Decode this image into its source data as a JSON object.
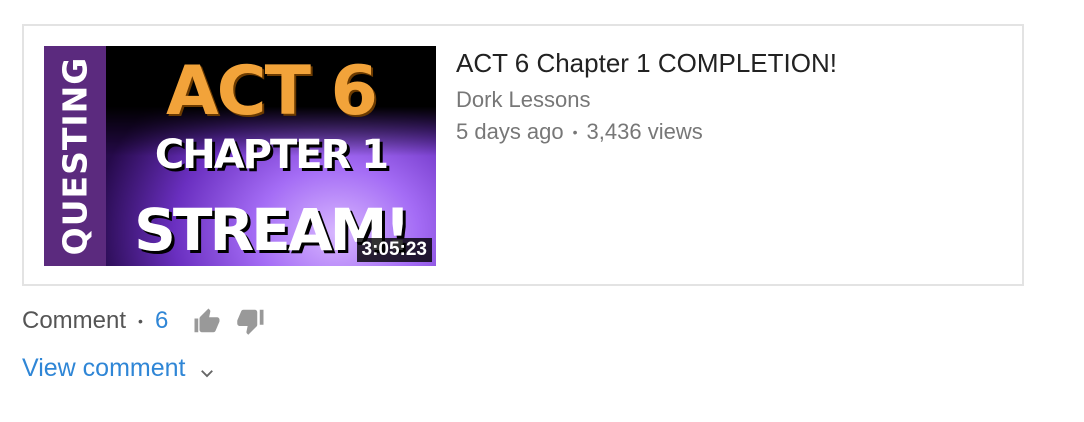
{
  "video": {
    "title": "ACT 6 Chapter 1 COMPLETION!",
    "channel": "Dork Lessons",
    "age": "5 days ago",
    "views": "3,436 views",
    "duration": "3:05:23",
    "thumbnail": {
      "side_text": "QUESTING",
      "line1": "ACT 6",
      "line2": "CHAPTER 1",
      "line3": "STREAM!"
    }
  },
  "actions": {
    "comment_label": "Comment",
    "comment_count": "6",
    "like_icon": "thumbs-up-icon",
    "dislike_icon": "thumbs-down-icon"
  },
  "view_comment": {
    "label": "View comment",
    "icon": "chevron-down-icon"
  },
  "colors": {
    "link_blue": "#2f86d6",
    "meta_gray": "#777777",
    "border": "#e3e3e3",
    "thumb_strip": "#5b2a7e",
    "thumb_orange": "#f2a33a"
  }
}
